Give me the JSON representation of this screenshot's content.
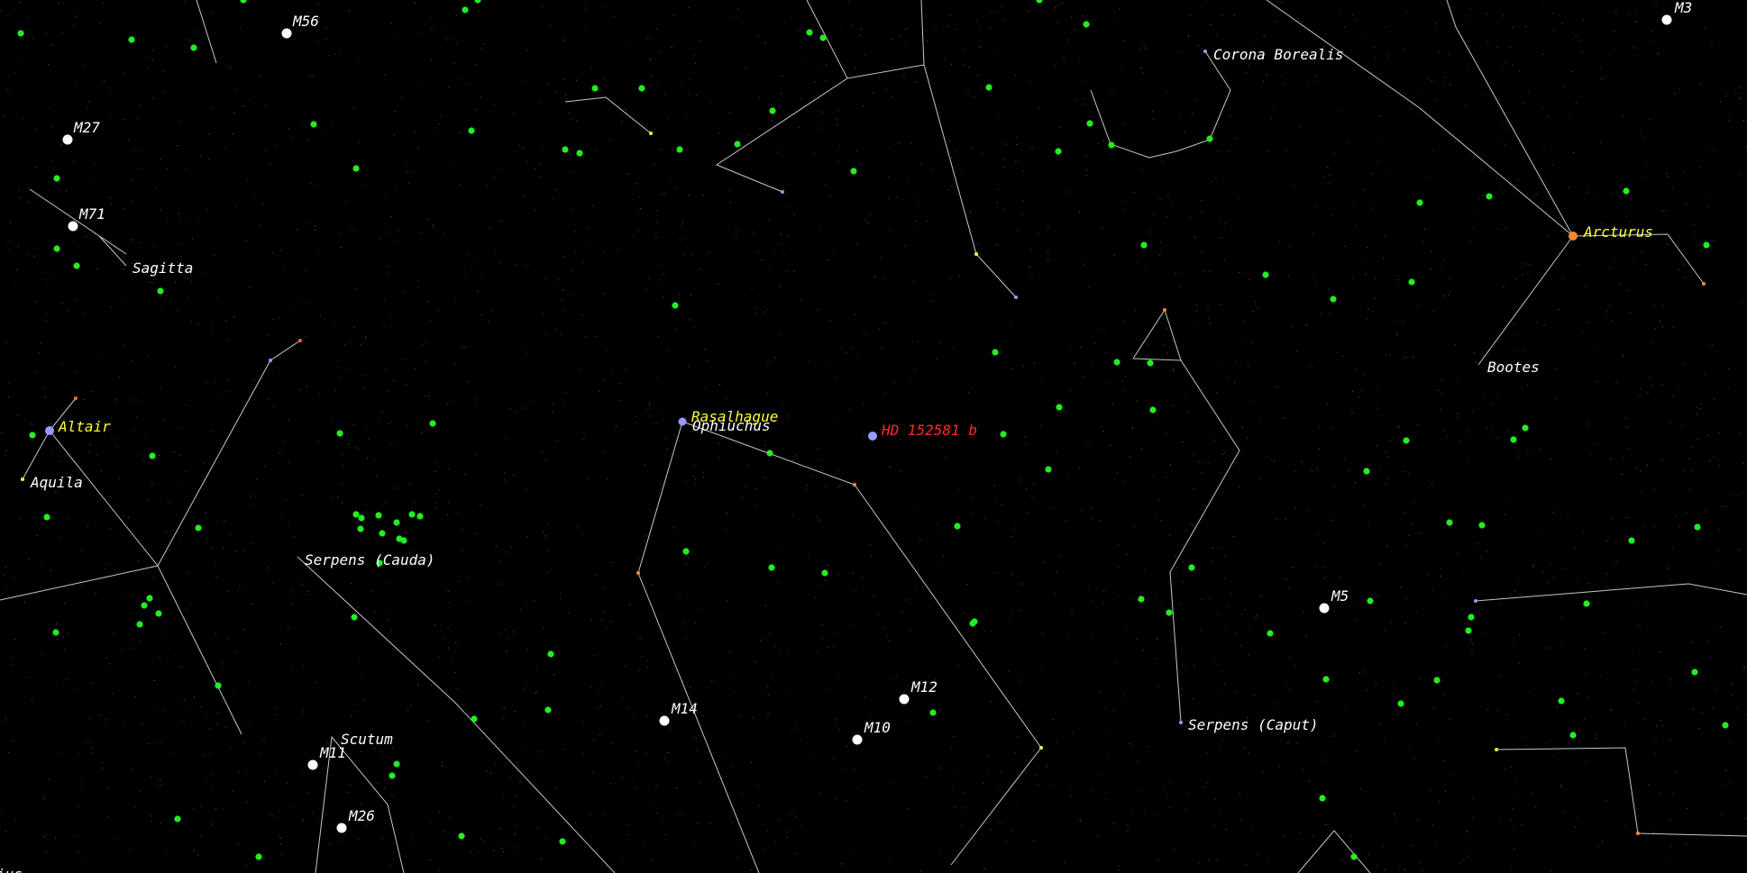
{
  "colors": {
    "background": "#000000",
    "constellation_line": "#c8c8c8",
    "label": "#ffffff",
    "bright_star_label": "#ffff33",
    "planet_host_label": "#ff2a2a",
    "galaxy_marker": "#22ee22",
    "cluster_marker": "#ffffff",
    "star_blue": "#9999ff",
    "star_orange": "#ff8833"
  },
  "constellation_labels": [
    "Corona Borealis",
    "Bootes",
    "Sagitta",
    "Aquila",
    "Serpens (Cauda)",
    "Serpens (Caput)",
    "Ophiuchus",
    "Scutum"
  ],
  "star_labels": [
    "Arcturus",
    "Altair",
    "Rasalhague"
  ],
  "target_label": "HD 152581 b",
  "deep_sky_labels": [
    "M3",
    "M56",
    "M27",
    "M71",
    "M5",
    "M12",
    "M10",
    "M14",
    "M11",
    "M26"
  ],
  "partial_edge_label": "ius"
}
